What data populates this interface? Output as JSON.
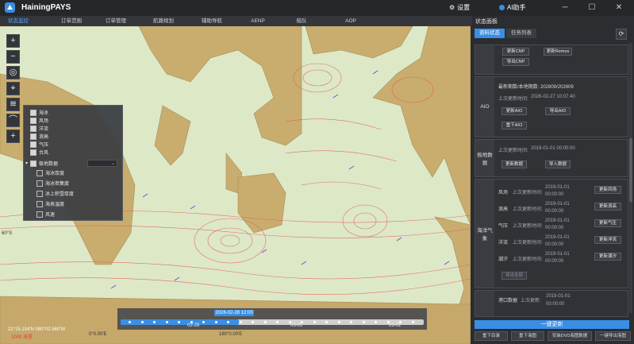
{
  "app": {
    "title": "HainingPAYS",
    "settings_label": "设置",
    "ai_label": "AI助手"
  },
  "menu": [
    {
      "label": "状态监控",
      "active": true
    },
    {
      "label": "订单范围",
      "active": false
    },
    {
      "label": "订单管理",
      "active": false
    },
    {
      "label": "航路规划",
      "active": false
    },
    {
      "label": "辅助导航",
      "active": false
    },
    {
      "label": "AENP",
      "active": false
    },
    {
      "label": "船队",
      "active": false
    },
    {
      "label": "AOP",
      "active": false
    }
  ],
  "map_tools": [
    "zoom-in",
    "zoom-out",
    "locate",
    "pin",
    "layers",
    "measure",
    "add"
  ],
  "layers": {
    "items": [
      {
        "label": "海冰",
        "checked": true
      },
      {
        "label": "风场",
        "checked": true
      },
      {
        "label": "洋流",
        "checked": true
      },
      {
        "label": "浪高",
        "checked": true
      },
      {
        "label": "气压",
        "checked": true
      },
      {
        "label": "台风",
        "checked": true
      }
    ],
    "polar_group": {
      "label": "极地数据",
      "checked": true
    },
    "polar_items": [
      {
        "label": "海冰厚度",
        "checked": false
      },
      {
        "label": "海冰密集度",
        "checked": false
      },
      {
        "label": "冰上积雪厚度",
        "checked": false
      },
      {
        "label": "海表温度",
        "checked": false
      },
      {
        "label": "风速",
        "checked": false
      }
    ]
  },
  "timeline": {
    "current": "2026-02-28 12:00",
    "labels": [
      "02-28",
      "03-01",
      "03-02"
    ],
    "position": 0.39
  },
  "map_labels": {
    "lon_left": "0°0.00'E",
    "lon_mid": "180°0.00'E",
    "lat_left": "60°S"
  },
  "coords": {
    "position": "21°15.104'N  080°02.560'W",
    "scale": "1000 海里"
  },
  "panel": {
    "title": "状态面板",
    "tabs": [
      {
        "label": "资料状态",
        "active": true
      },
      {
        "label": "任务列表",
        "active": false
      }
    ],
    "top_buttons": [
      "更新CNP",
      "更新Remos",
      "导出CNP"
    ],
    "aio": {
      "label": "AIO",
      "version_text": "最新期数/本地期数: 202809/202609",
      "update_time_label": "上次更新时间:",
      "update_time": "2026-02-27 10:07:40",
      "buttons": [
        "更新AIO",
        "导出AIO",
        "重下AIO"
      ]
    },
    "polar": {
      "label": "极地数据",
      "update_time_label": "上次更新时间:",
      "update_time": "2019-01-01 00:00:00",
      "buttons": [
        "更新数据",
        "导入数据"
      ]
    },
    "weather": {
      "label": "海洋气象",
      "rows": [
        {
          "name": "风场",
          "update_label": "上次更新时间:",
          "date": "2019-01-01",
          "time": "00:00:00",
          "button": "更新风场"
        },
        {
          "name": "浪高",
          "update_label": "上次更新时间:",
          "date": "2019-01-01",
          "time": "00:00:00",
          "button": "更新浪高"
        },
        {
          "name": "气压",
          "update_label": "上次更新时间:",
          "date": "2019-01-01",
          "time": "00:00:00",
          "button": "更新气压"
        },
        {
          "name": "洋流",
          "update_label": "上次更新时间:",
          "date": "2019-01-01",
          "time": "00:00:00",
          "button": "更新洋流"
        },
        {
          "name": "潮汐",
          "update_label": "上次更新时间:",
          "date": "2019-01-01",
          "time": "00:00:00",
          "button": "更新潮汐"
        }
      ],
      "extra_button": "导出全部"
    },
    "port": {
      "name": "港口数据",
      "update_label": "上次更新:",
      "date": "2019-01-01",
      "time": "00:00:00"
    },
    "update_all": "一键更新",
    "bottom_buttons": [
      "重下目录",
      "重下海图",
      "安装DVD海图数据",
      "一键导出海图"
    ]
  },
  "colors": {
    "accent": "#3a8ee6",
    "land": "#c9ad6e",
    "ocean": "#dde8c7",
    "isobar": "#e35a5a",
    "wind": "#6a3fd0"
  }
}
